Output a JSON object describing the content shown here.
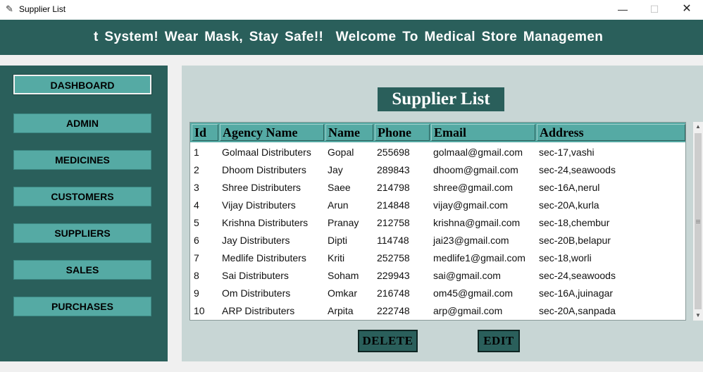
{
  "window": {
    "title": "Supplier List",
    "minimize_glyph": "—",
    "maximize_glyph": "☐",
    "close_glyph": "✕",
    "icon": "feather-icon"
  },
  "banner": {
    "text": "t System! Wear Mask, Stay Safe!!  Welcome To Medical Store Managemen"
  },
  "sidebar": {
    "items": [
      {
        "label": "DASHBOARD"
      },
      {
        "label": "ADMIN"
      },
      {
        "label": "MEDICINES"
      },
      {
        "label": "CUSTOMERS"
      },
      {
        "label": "SUPPLIERS"
      },
      {
        "label": "SALES"
      },
      {
        "label": "PURCHASES"
      }
    ]
  },
  "main": {
    "heading": "Supplier List",
    "columns": [
      "Id",
      "Agency Name",
      "Name",
      "Phone",
      "Email",
      "Address"
    ],
    "rows": [
      [
        "1",
        "Golmaal Distributers",
        "Gopal",
        "255698",
        "golmaal@gmail.com",
        "sec-17,vashi"
      ],
      [
        "2",
        "Dhoom Distributers",
        "Jay",
        "289843",
        "dhoom@gmail.com",
        "sec-24,seawoods"
      ],
      [
        "3",
        "Shree Distributers",
        "Saee",
        "214798",
        "shree@gmail.com",
        "sec-16A,nerul"
      ],
      [
        "4",
        "Vijay Distributers",
        "Arun",
        "214848",
        "vijay@gmail.com",
        "sec-20A,kurla"
      ],
      [
        "5",
        "Krishna Distributers",
        "Pranay",
        "212758",
        "krishna@gmail.com",
        "sec-18,chembur"
      ],
      [
        "6",
        "Jay Distributers",
        "Dipti",
        "114748",
        "jai23@gmail.com",
        "sec-20B,belapur"
      ],
      [
        "7",
        "Medlife Distributers",
        "Kriti",
        "252758",
        "medlife1@gmail.com",
        "sec-18,worli"
      ],
      [
        "8",
        "Sai Distributers",
        "Soham",
        "229943",
        "sai@gmail.com",
        "sec-24,seawoods"
      ],
      [
        "9",
        "Om Distributers",
        "Omkar",
        "216748",
        "om45@gmail.com",
        "sec-16A,juinagar"
      ],
      [
        "10",
        "ARP Distributers",
        "Arpita",
        "222748",
        "arp@gmail.com",
        "sec-20A,sanpada"
      ]
    ],
    "delete_label": "DELETE",
    "edit_label": "EDIT"
  },
  "colors": {
    "primary": "#2a5f5b",
    "accent": "#55aaa4",
    "panel": "#c8d6d5"
  }
}
